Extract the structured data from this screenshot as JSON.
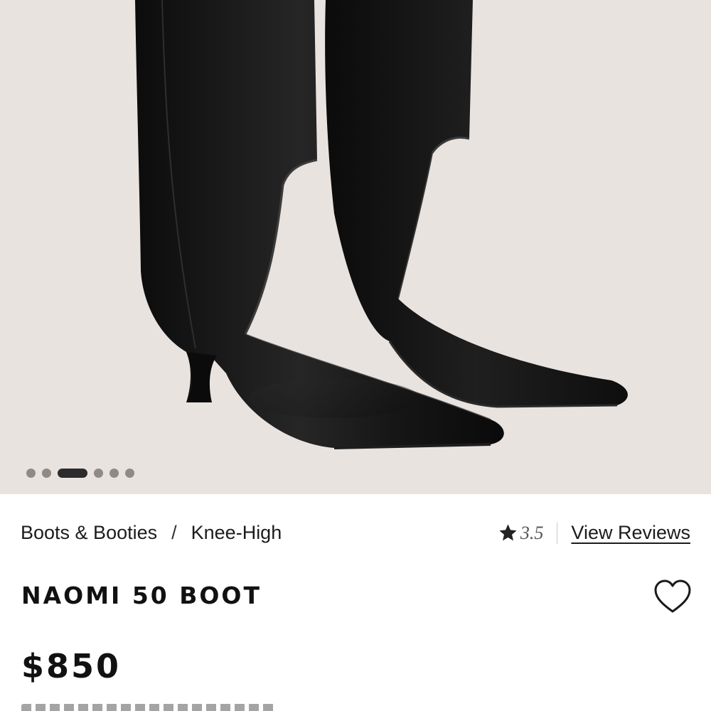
{
  "product": {
    "image_alt": "Black leather knee-high boots with pointed toe and kitten heel",
    "carousel": {
      "total": 6,
      "active_index": 2
    },
    "breadcrumb": {
      "category": "Boots & Booties",
      "separator": "/",
      "subcategory": "Knee-High"
    },
    "rating": {
      "score": "3.5",
      "reviews_link": "View Reviews"
    },
    "name": "NAOMI 50 BOOT",
    "price": "$850"
  },
  "colors": {
    "image_background": "#e9e3e0",
    "boot_leather": "#141414",
    "text": "#1a1a1a",
    "dot_inactive": "#8e8a88",
    "dot_active": "#2b2b2b"
  },
  "icons": {
    "rating": "star-icon",
    "wishlist": "heart-outline-icon"
  }
}
